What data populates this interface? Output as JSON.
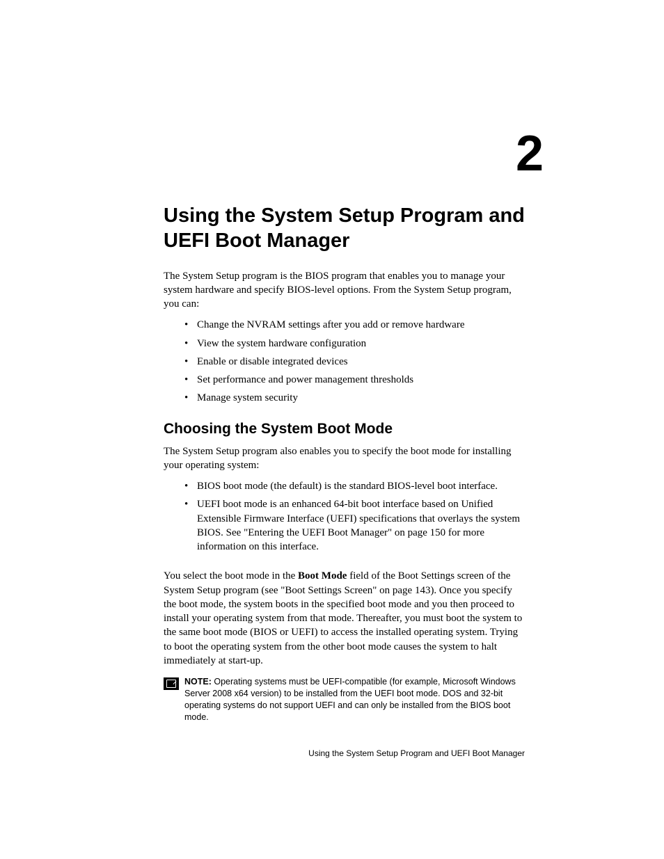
{
  "chapter_number": "2",
  "chapter_title": "Using the System Setup Program and UEFI Boot Manager",
  "intro_paragraph": "The System Setup program is the BIOS program that enables you to manage your system hardware and specify BIOS-level options. From the System Setup program, you can:",
  "intro_bullets": [
    "Change the NVRAM settings after you add or remove hardware",
    "View the system hardware configuration",
    "Enable or disable integrated devices",
    "Set performance and power management thresholds",
    "Manage system security"
  ],
  "section_heading": "Choosing the System Boot Mode",
  "section_intro": "The System Setup program also enables you to specify the boot mode for installing your operating system:",
  "section_bullets": [
    "BIOS boot mode (the default) is the standard BIOS-level boot interface.",
    "UEFI boot mode is an enhanced 64-bit boot interface based on Unified Extensible Firmware Interface (UEFI) specifications that overlays the system BIOS. See \"Entering the UEFI Boot Manager\" on page 150 for more information on this interface."
  ],
  "body_paragraph_pre": "You select the boot mode in the ",
  "body_paragraph_bold": "Boot Mode",
  "body_paragraph_post": " field of the Boot Settings screen of the System Setup program (see \"Boot Settings Screen\" on page 143). Once you specify the boot mode, the system boots in the specified boot mode and you then proceed to install your operating system from that mode. Thereafter, you must boot the system to the same boot mode (BIOS or UEFI) to access the installed operating system. Trying to boot the operating system from the other boot mode causes the system to halt immediately at start-up.",
  "note_label": "NOTE:",
  "note_text": " Operating systems must be UEFI-compatible (for example, Microsoft Windows Server 2008 x64 version) to be installed from the UEFI boot mode. DOS and 32-bit operating systems do not support UEFI and can only be installed from the BIOS boot mode.",
  "footer_text": "Using the System Setup Program and UEFI Boot Manager"
}
